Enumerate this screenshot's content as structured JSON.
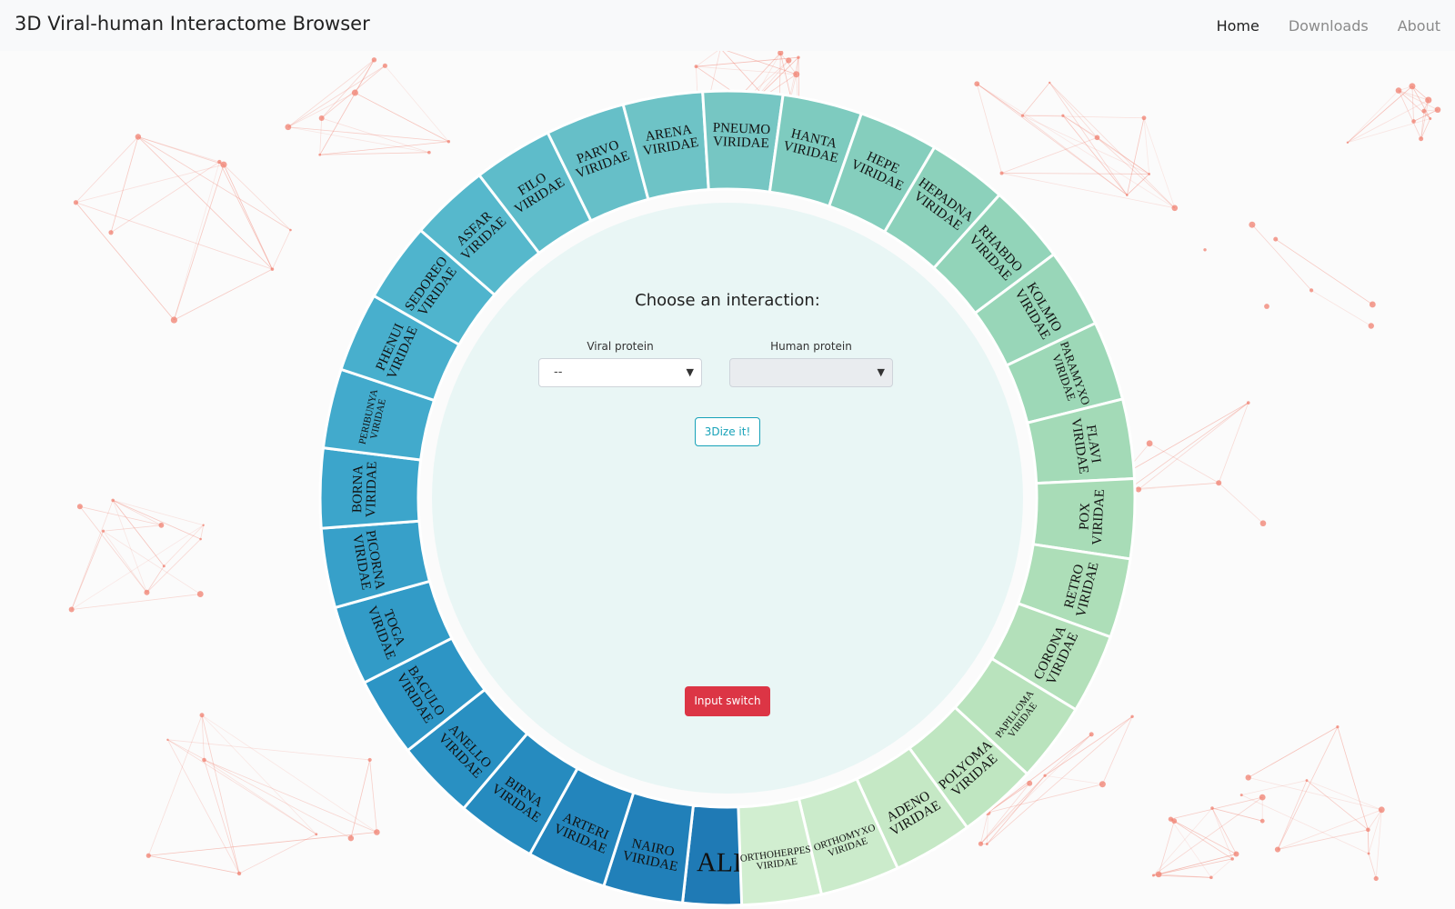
{
  "navbar": {
    "brand": "3D Viral-human Interactome Browser",
    "links": [
      {
        "label": "Home",
        "active": true
      },
      {
        "label": "Downloads",
        "active": false
      },
      {
        "label": "About",
        "active": false
      }
    ]
  },
  "wheel": {
    "sectors": [
      {
        "lines": [
          "ALL"
        ],
        "color": "#1f7ab5"
      },
      {
        "lines": [
          "NAIRO",
          "VIRIDAE"
        ],
        "color": "#2180b9"
      },
      {
        "lines": [
          "ARTERI",
          "VIRIDAE"
        ],
        "color": "#2385bc"
      },
      {
        "lines": [
          "BIRNA",
          "VIRIDAE"
        ],
        "color": "#268bbf"
      },
      {
        "lines": [
          "ANELLO",
          "VIRIDAE"
        ],
        "color": "#2990c2"
      },
      {
        "lines": [
          "BACULO",
          "VIRIDAE"
        ],
        "color": "#2d95c5"
      },
      {
        "lines": [
          "TOGA",
          "VIRIDAE"
        ],
        "color": "#329bc7"
      },
      {
        "lines": [
          "PICORNA",
          "VIRIDAE"
        ],
        "color": "#37a0c9"
      },
      {
        "lines": [
          "BORNA",
          "VIRIDAE"
        ],
        "color": "#3ca5cb"
      },
      {
        "lines": [
          "PERIBUNYA",
          "VIRIDAE"
        ],
        "color": "#42aacc"
      },
      {
        "lines": [
          "PHENUI",
          "VIRIDAE"
        ],
        "color": "#48afcd"
      },
      {
        "lines": [
          "SEDOREO",
          "VIRIDAE"
        ],
        "color": "#4fb4cd"
      },
      {
        "lines": [
          "ASFAR",
          "VIRIDAE"
        ],
        "color": "#56b8cc"
      },
      {
        "lines": [
          "FILO",
          "VIRIDAE"
        ],
        "color": "#5ebcca"
      },
      {
        "lines": [
          "PARVO",
          "VIRIDAE"
        ],
        "color": "#66bfc8"
      },
      {
        "lines": [
          "ARENA",
          "VIRIDAE"
        ],
        "color": "#6ec3c6"
      },
      {
        "lines": [
          "PNEUMO",
          "VIRIDAE"
        ],
        "color": "#76c6c3"
      },
      {
        "lines": [
          "HANTA",
          "VIRIDAE"
        ],
        "color": "#7ecbbf"
      },
      {
        "lines": [
          "HEPE",
          "VIRIDAE"
        ],
        "color": "#85cebd"
      },
      {
        "lines": [
          "HEPADNA",
          "VIRIDAE"
        ],
        "color": "#8cd1bb"
      },
      {
        "lines": [
          "RHABDO",
          "VIRIDAE"
        ],
        "color": "#92d4b9"
      },
      {
        "lines": [
          "KOLMIO",
          "VIRIDAE"
        ],
        "color": "#98d6b8"
      },
      {
        "lines": [
          "PARAMYXO",
          "VIRIDAE"
        ],
        "color": "#9dd8b7"
      },
      {
        "lines": [
          "FLAVI",
          "VIRIDAE"
        ],
        "color": "#a3dab7"
      },
      {
        "lines": [
          "POX",
          "VIRIDAE"
        ],
        "color": "#a8dcb7"
      },
      {
        "lines": [
          "RETRO",
          "VIRIDAE"
        ],
        "color": "#addeb8"
      },
      {
        "lines": [
          "CORONA",
          "VIRIDAE"
        ],
        "color": "#b3e0ba"
      },
      {
        "lines": [
          "PAPILLOMA",
          "VIRIDAE"
        ],
        "color": "#b9e3bd"
      },
      {
        "lines": [
          "POLYOMA",
          "VIRIDAE"
        ],
        "color": "#bfe6c1"
      },
      {
        "lines": [
          "ADENO",
          "VIRIDAE"
        ],
        "color": "#c5e8c5"
      },
      {
        "lines": [
          "ORTHOMYXO",
          "VIRIDAE"
        ],
        "color": "#cbebcb"
      },
      {
        "lines": [
          "ORTHOHERPES",
          "VIRIDAE"
        ],
        "color": "#d1eed0"
      }
    ]
  },
  "interaction": {
    "title": "Choose an interaction:",
    "viral_label": "Viral protein",
    "viral_value": "--",
    "human_label": "Human protein",
    "human_value": "",
    "submit_label": "3Dize it!",
    "switch_label": "Input switch"
  },
  "icons": {
    "select_chevron": "chevron-down-icon"
  },
  "colors": {
    "inner_circle": "#e9f6f5",
    "network": "#f08070",
    "outline_button": "#17a2b8",
    "danger_button": "#dc3545"
  }
}
